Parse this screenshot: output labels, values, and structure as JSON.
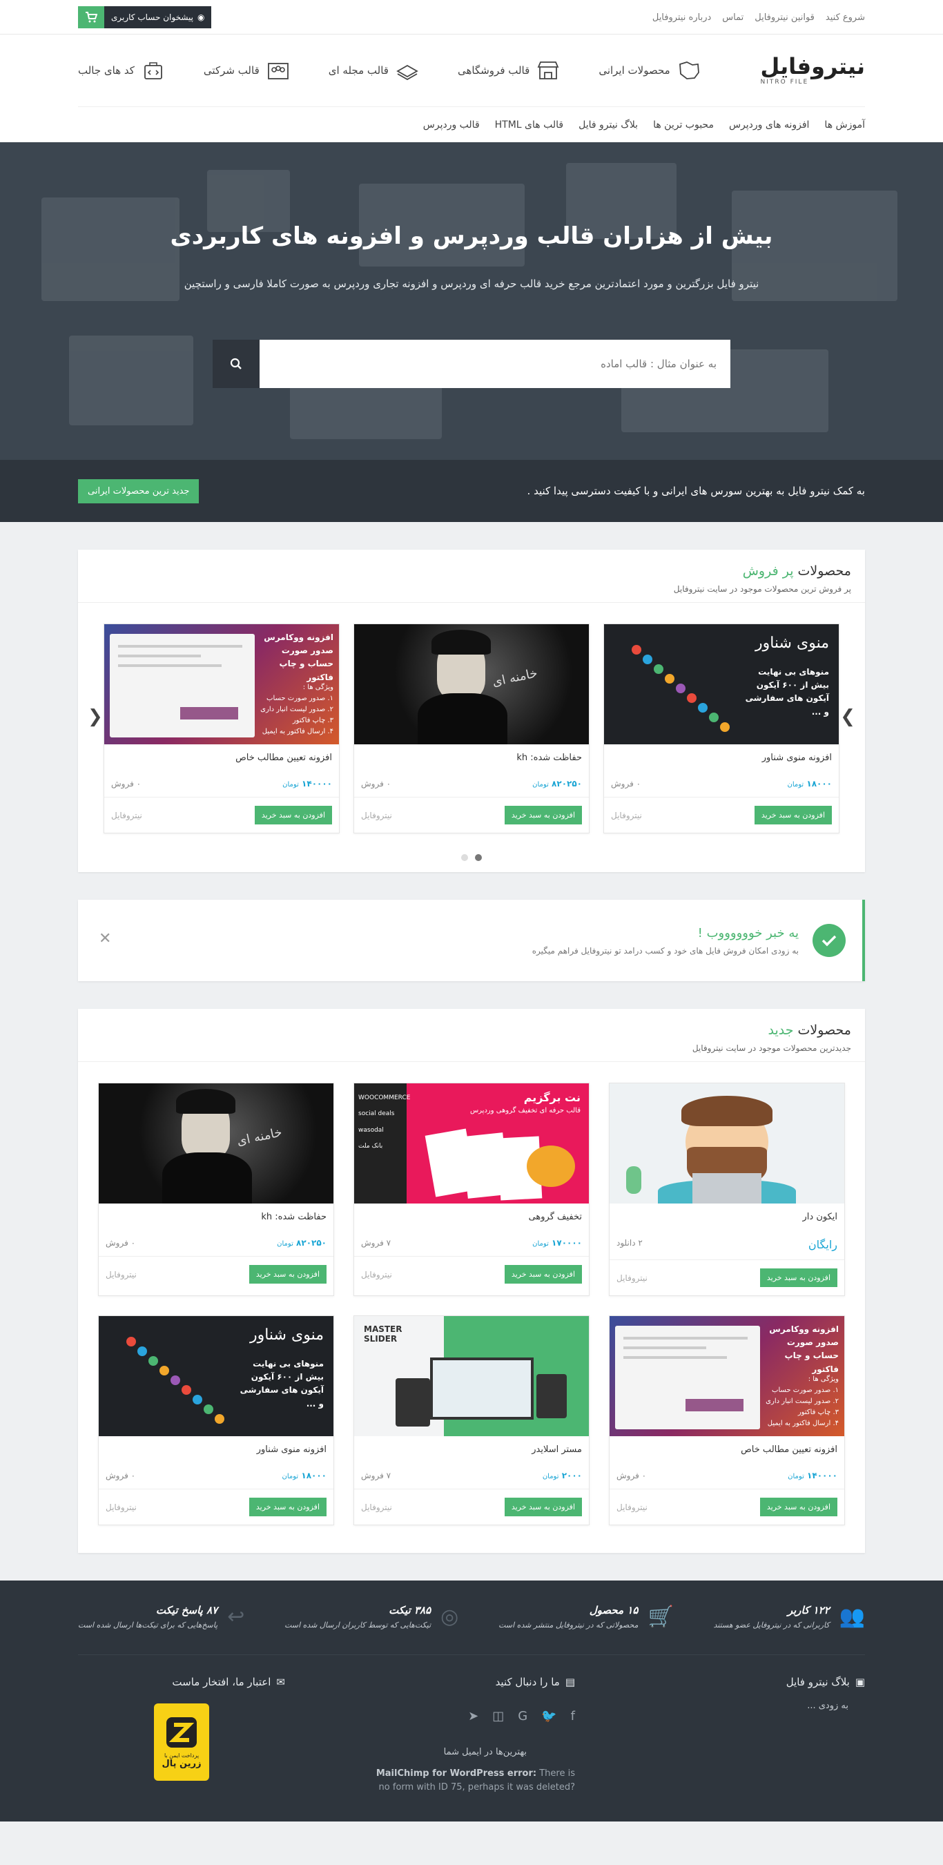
{
  "topbar": {
    "links": [
      "شروع کنید",
      "قوانین نیتروفایل",
      "تماس",
      "درباره نیتروفایل"
    ],
    "account_label": "پیشخوان حساب کاربری"
  },
  "header": {
    "logo_fa": "نیتروفایل",
    "logo_en": "NITRO FILE",
    "categories": [
      {
        "label": "محصولات ایرانی",
        "icon": "iran-map-icon"
      },
      {
        "label": "قالب فروشگاهی",
        "icon": "store-icon"
      },
      {
        "label": "قالب مجله ای",
        "icon": "magazine-icon"
      },
      {
        "label": "قالب شرکتی",
        "icon": "company-icon"
      },
      {
        "label": "کد های جالب",
        "icon": "code-bag-icon"
      }
    ],
    "nav": [
      "آموزش ها",
      "افزونه های وردپرس",
      "محبوب ترین ها",
      "بلاگ نیترو فایل",
      "قالب های HTML",
      "قالب وردپرس"
    ]
  },
  "hero": {
    "title": "بیش از هزاران قالب وردپرس و افزونه های کاربردی",
    "subtitle": "نیترو فایل بزرگترین و مورد اعتمادترین مرجع خرید قالب حرفه ای وردپرس و افزونه تجاری وردپرس به صورت کاملا فارسی و راستچین",
    "search_placeholder": "به عنوان مثال : قالب اماده"
  },
  "strip": {
    "text": "به کمک نیترو فایل به بهترین سورس های ایرانی و با کیفیت دسترسی پیدا کنید .",
    "button": "جدید ترین محصولات ایرانی"
  },
  "bestsellers": {
    "title_prefix": "محصولات",
    "title_accent": "پر فروش",
    "desc": "پر فروش ترین محصولات موجود در سایت نیتروفایل",
    "items": [
      {
        "title": "افزونه منوی شناور",
        "price": "۱۸۰۰۰",
        "currency": "تومان",
        "stat": "۰ فروش",
        "button": "افزودن به سبد خرید",
        "brand": "نیتروفایل",
        "thumb": "menu"
      },
      {
        "title": "حفاظت شده: kh",
        "price": "۸۲۰۲۵۰",
        "currency": "تومان",
        "stat": "۰ فروش",
        "button": "افزودن به سبد خرید",
        "brand": "نیتروفایل",
        "thumb": "leader"
      },
      {
        "title": "افزونه تعیین مطالب خاص",
        "price": "۱۴۰۰۰۰",
        "currency": "تومان",
        "stat": "۰ فروش",
        "button": "افزودن به سبد خرید",
        "brand": "نیتروفایل",
        "thumb": "woo"
      }
    ]
  },
  "alert": {
    "title": "یه خبر خووووووب !",
    "desc": "به زودی امکان فروش فایل های خود و کسب درامد تو نیتروفایل فراهم میگیره"
  },
  "newest": {
    "title_prefix": "محصولات",
    "title_accent": "جدید",
    "desc": "جدیدترین محصولات موجود در سایت نیتروفایل",
    "items": [
      {
        "title": "ایکون دار",
        "price": "رایگان",
        "currency": "",
        "stat": "۲ دانلود",
        "button": "افزودن به سبد خرید",
        "brand": "نیتروفایل",
        "thumb": "avatar",
        "free": true
      },
      {
        "title": "تخفیف گروهی",
        "price": "۱۷۰۰۰۰",
        "currency": "تومان",
        "stat": "۷ فروش",
        "button": "افزودن به سبد خرید",
        "brand": "نیتروفایل",
        "thumb": "group"
      },
      {
        "title": "حفاظت شده: kh",
        "price": "۸۲۰۲۵۰",
        "currency": "تومان",
        "stat": "۰ فروش",
        "button": "افزودن به سبد خرید",
        "brand": "نیتروفایل",
        "thumb": "leader"
      },
      {
        "title": "افزونه تعیین مطالب خاص",
        "price": "۱۴۰۰۰۰",
        "currency": "تومان",
        "stat": "۰ فروش",
        "button": "افزودن به سبد خرید",
        "brand": "نیتروفایل",
        "thumb": "woo"
      },
      {
        "title": "مستر اسلایدر",
        "price": "۲۰۰۰",
        "currency": "تومان",
        "stat": "۷ فروش",
        "button": "افزودن به سبد خرید",
        "brand": "نیتروفایل",
        "thumb": "master"
      },
      {
        "title": "افزونه منوی شناور",
        "price": "۱۸۰۰۰",
        "currency": "تومان",
        "stat": "۰ فروش",
        "button": "افزودن به سبد خرید",
        "brand": "نیتروفایل",
        "thumb": "menu"
      }
    ]
  },
  "thumbs": {
    "menu_title": "منوی شناور",
    "menu_lines": [
      "منوهای بی نهایت",
      "بیش از ۶۰۰ آیکون",
      "آیکون های سفارشی",
      "و ..."
    ],
    "woo_title": "افزونه ووکامرس صدور صورت حساب و چاپ فاکتور",
    "woo_lines": [
      "ویژگی ها :",
      "۱. صدور صورت حساب",
      "۲. صدور لیست انبار داری",
      "۳. چاپ فاکتور",
      "۴. ارسال فاکتور به ایمیل"
    ],
    "group_title": "نت برگزیم",
    "group_sub": "قالب حرفه ای تخفیف گروهی وردپرس",
    "group_brands": [
      "WOOCOMMERCE",
      "social deals",
      "wasodal",
      "بانک ملت"
    ],
    "master_logo": "MASTER SLIDER",
    "leader_caption": "خامنه ای"
  },
  "footer": {
    "stats": [
      {
        "title": "۱۲۲ کاربر",
        "desc": "کاربرانی که در نیتروفایل عضو هستند",
        "icon": "users-icon"
      },
      {
        "title": "۱۵ محصول",
        "desc": "محصولاتی که در نیتروفایل منتشر شده است",
        "icon": "cart-icon"
      },
      {
        "title": "۳۸۵ تیکت",
        "desc": "تیکت‌هایی که توسط کاربران ارسال شده است",
        "icon": "lifebuoy-icon"
      },
      {
        "title": "۸۷ پاسخ تیکت",
        "desc": "پاسخ‌هایی که برای تیکت‌ها ارسال شده است",
        "icon": "reply-icon"
      }
    ],
    "blog_title": "بلاگ نیترو فایل",
    "blog_text": "به زودی ...",
    "follow_title": "ما را دنبال کنید",
    "newsletter": "بهترین‌ها در ایمیل شما",
    "mailchimp_label": "MailChimp for WordPress error:",
    "mailchimp_msg": "There is no form with ID 75, perhaps it was deleted?",
    "trust_title": "اعتبار ما، افتخار ماست",
    "zarinpal_text": "پرداخت ایمن با",
    "zarinpal_name": "زرین پال"
  },
  "colors": {
    "accent": "#4cb672",
    "price": "#1aa5d4",
    "dark": "#2e353d"
  }
}
